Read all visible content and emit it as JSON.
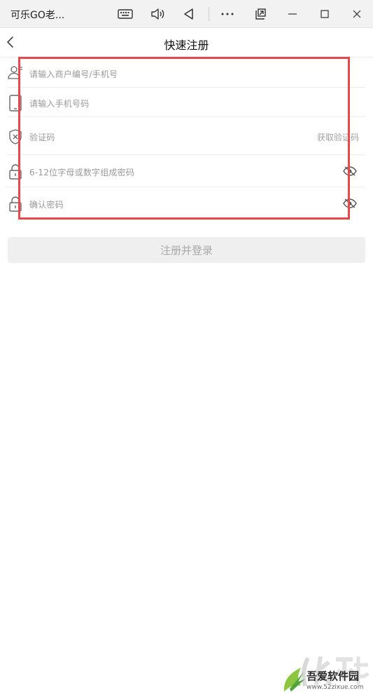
{
  "window": {
    "title": "可乐GO老..."
  },
  "header": {
    "title": "快速注册"
  },
  "form": {
    "account_placeholder": "请输入商户编号/手机号",
    "phone_placeholder": "请输入手机号码",
    "code_placeholder": "验证码",
    "get_code_label": "获取验证码",
    "password_placeholder": "6-12位字母或数字组成密码",
    "confirm_placeholder": "确认密码"
  },
  "submit_label": "注册并登录",
  "watermark": {
    "text": "吾爱软件园",
    "url": "www.52zixue.com"
  },
  "colors": {
    "highlight": "#e8474c",
    "button_bg": "#efefef",
    "placeholder": "#9a9a9a"
  }
}
